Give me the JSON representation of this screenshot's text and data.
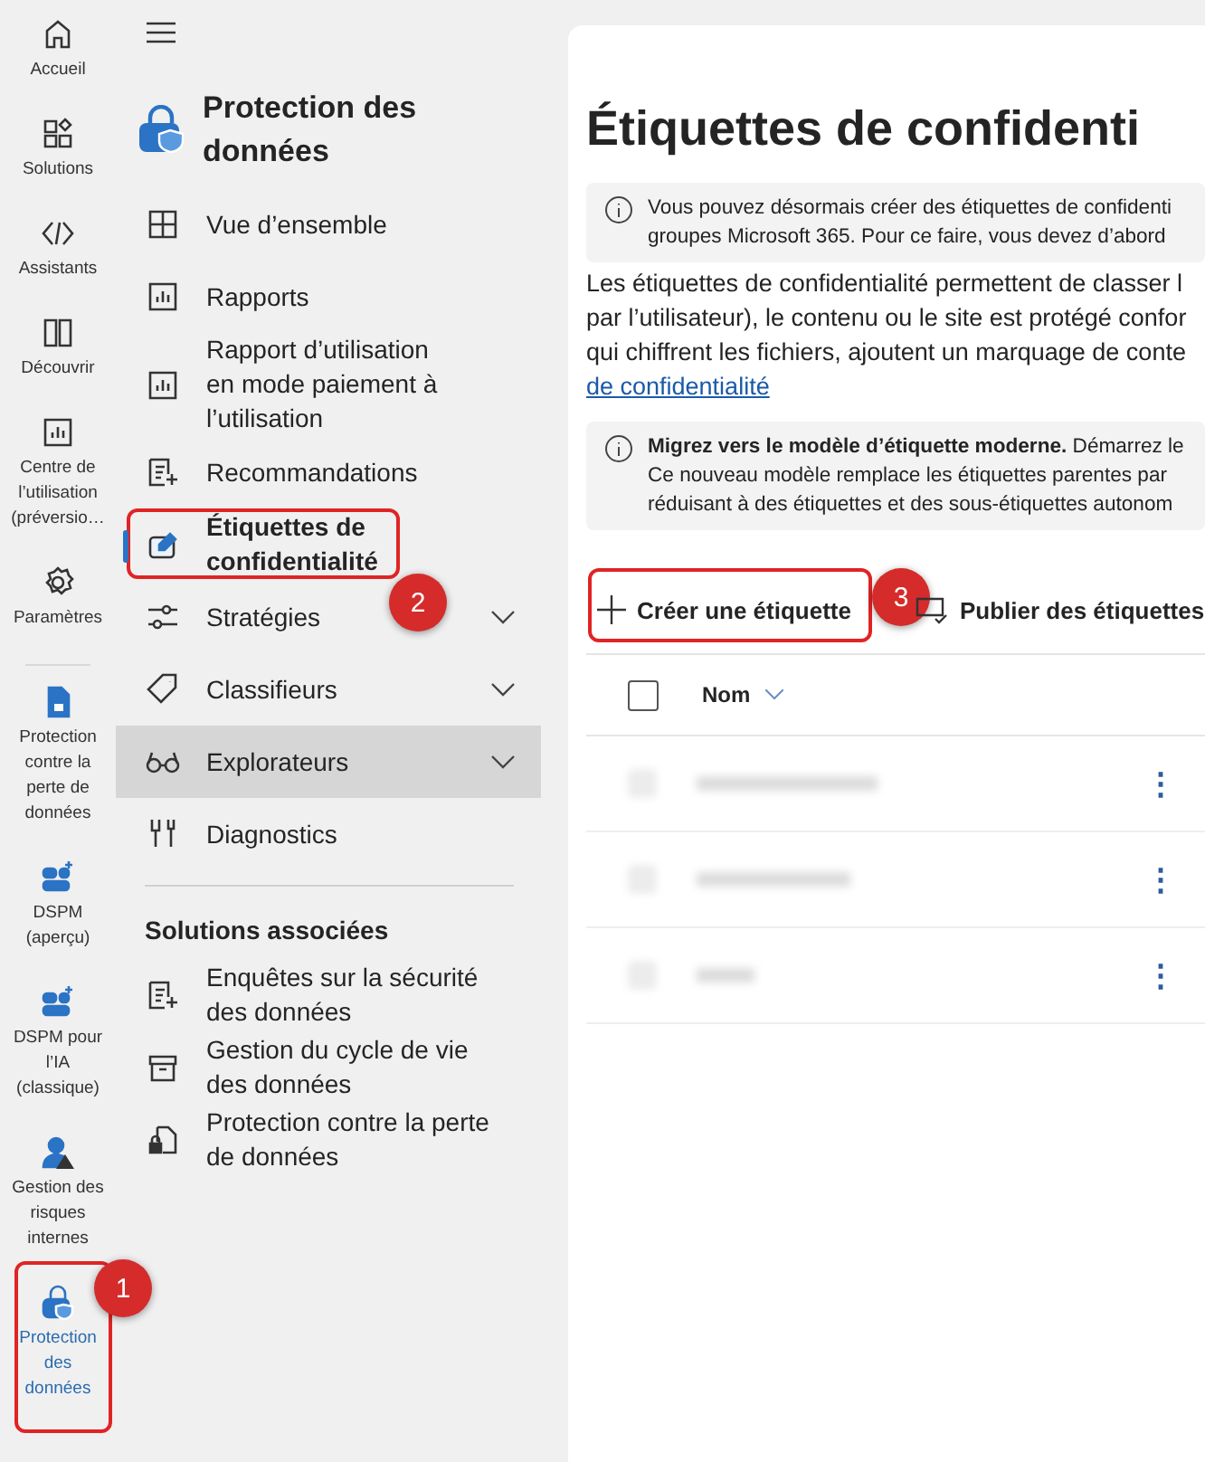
{
  "rail": [
    {
      "label": "Accueil",
      "selected": false
    },
    {
      "label": "Solutions",
      "selected": false
    },
    {
      "label": "Assistants",
      "selected": false
    },
    {
      "label": "Découvrir",
      "selected": false
    },
    {
      "label": "Centre de l’utilisation (préversio…",
      "selected": false
    },
    {
      "label": "Paramètres",
      "selected": false
    },
    {
      "label": "Protection contre la perte de données",
      "selected": false
    },
    {
      "label": "DSPM (aperçu)",
      "selected": false
    },
    {
      "label": "DSPM pour l’IA (classique)",
      "selected": false
    },
    {
      "label": "Gestion des risques internes",
      "selected": false
    },
    {
      "label": "Protection des données",
      "selected": true
    }
  ],
  "nav": {
    "title": "Protection des données",
    "items": [
      {
        "label": "Vue d’ensemble",
        "selected": false,
        "highlighted": false,
        "has_submenu": false
      },
      {
        "label": "Rapports",
        "selected": false,
        "highlighted": false,
        "has_submenu": false
      },
      {
        "label": "Rapport d’utilisation en mode paiement à l’utilisation",
        "selected": false,
        "highlighted": false,
        "has_submenu": false
      },
      {
        "label": "Recommandations",
        "selected": false,
        "highlighted": false,
        "has_submenu": false
      },
      {
        "label": "Étiquettes de confidentialité",
        "selected": true,
        "highlighted": false,
        "has_submenu": false
      },
      {
        "label": "Stratégies",
        "selected": false,
        "highlighted": false,
        "has_submenu": true
      },
      {
        "label": "Classifieurs",
        "selected": false,
        "highlighted": false,
        "has_submenu": true
      },
      {
        "label": "Explorateurs",
        "selected": false,
        "highlighted": true,
        "has_submenu": true
      },
      {
        "label": "Diagnostics",
        "selected": false,
        "highlighted": false,
        "has_submenu": false
      }
    ],
    "related_heading": "Solutions associées",
    "related": [
      {
        "label": "Enquêtes sur la sécurité des données"
      },
      {
        "label": "Gestion du cycle de vie des données"
      },
      {
        "label": "Protection contre la perte de données"
      }
    ]
  },
  "main": {
    "title": "Étiquettes de confidenti",
    "notice_1": [
      "Vous pouvez désormais créer des étiquettes de confidenti",
      "groupes Microsoft 365. Pour ce faire, vous devez d’abord"
    ],
    "description": [
      "Les étiquettes de confidentialité permettent de classer l",
      "par l’utilisateur), le contenu ou le site est protégé confor",
      "qui chiffrent les fichiers, ajoutent un marquage de conte"
    ],
    "description_link": "de confidentialité",
    "notice_2": [
      "**Migrez vers le modèle d’étiquette moderne.** Démarrez le",
      "Ce nouveau modèle remplace les étiquettes parentes par",
      "réduisant à des étiquettes et des sous-étiquettes autonom"
    ],
    "toolbar": [
      "Créer une étiquette",
      "Publier des étiquettes"
    ],
    "table": {
      "select_all_checked": false,
      "columns": [
        "Nom"
      ],
      "rows": [
        {
          "selected": false,
          "menu": "⋮"
        },
        {
          "selected": false,
          "menu": "⋮"
        },
        {
          "selected": false,
          "menu": "⋮"
        }
      ]
    }
  },
  "annotations": [
    {
      "number": "1"
    },
    {
      "number": "2"
    },
    {
      "number": "3"
    }
  ]
}
